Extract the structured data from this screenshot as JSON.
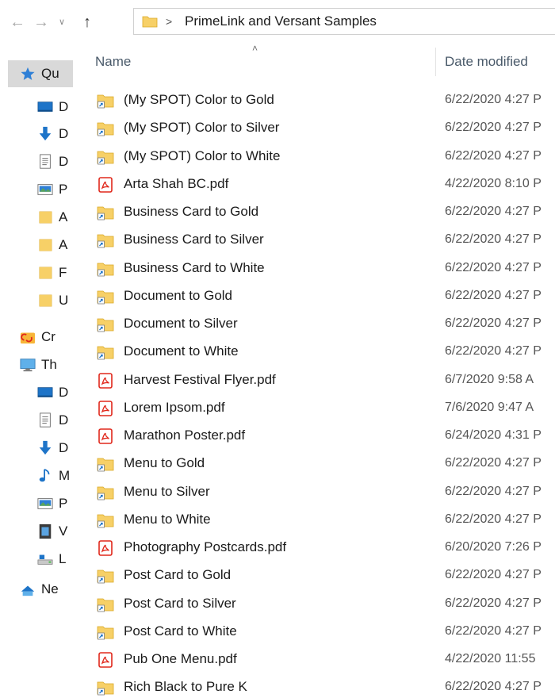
{
  "address_bar": {
    "breadcrumb_separator": ">",
    "current_folder": "PrimeLink and Versant Samples"
  },
  "nav_pane": {
    "items": [
      {
        "icon": "star-icon",
        "label": "Qu",
        "selected": true
      },
      {
        "icon": "desktop-icon",
        "label": "D"
      },
      {
        "icon": "download-icon",
        "label": "D"
      },
      {
        "icon": "documents-icon",
        "label": "D"
      },
      {
        "icon": "pictures-icon",
        "label": "P"
      },
      {
        "icon": "folder-icon",
        "label": "A"
      },
      {
        "icon": "folder-icon",
        "label": "A"
      },
      {
        "icon": "folder-icon",
        "label": "F"
      },
      {
        "icon": "folder-icon",
        "label": "U"
      },
      {
        "icon": "creative-cloud-icon",
        "label": "Cr"
      },
      {
        "icon": "this-pc-icon",
        "label": "Th"
      },
      {
        "icon": "desktop-icon",
        "label": "D"
      },
      {
        "icon": "documents-icon",
        "label": "D"
      },
      {
        "icon": "download-icon",
        "label": "D"
      },
      {
        "icon": "music-icon",
        "label": "M"
      },
      {
        "icon": "pictures-icon",
        "label": "P"
      },
      {
        "icon": "videos-icon",
        "label": "V"
      },
      {
        "icon": "local-disk-icon",
        "label": "L"
      },
      {
        "icon": "network-icon",
        "label": "Ne"
      }
    ]
  },
  "columns": {
    "name": "Name",
    "date_modified": "Date modified"
  },
  "files": [
    {
      "name": "(My SPOT) Color to Gold",
      "date": "6/22/2020 4:27 P",
      "type": "folder-shortcut"
    },
    {
      "name": "(My SPOT) Color to Silver",
      "date": "6/22/2020 4:27 P",
      "type": "folder-shortcut"
    },
    {
      "name": "(My SPOT) Color to White",
      "date": "6/22/2020 4:27 P",
      "type": "folder-shortcut"
    },
    {
      "name": "Arta Shah BC.pdf",
      "date": "4/22/2020 8:10 P",
      "type": "pdf"
    },
    {
      "name": "Business Card to Gold",
      "date": "6/22/2020 4:27 P",
      "type": "folder-shortcut"
    },
    {
      "name": "Business Card to Silver",
      "date": "6/22/2020 4:27 P",
      "type": "folder-shortcut"
    },
    {
      "name": "Business Card to White",
      "date": "6/22/2020 4:27 P",
      "type": "folder-shortcut"
    },
    {
      "name": "Document to Gold",
      "date": "6/22/2020 4:27 P",
      "type": "folder-shortcut"
    },
    {
      "name": "Document to Silver",
      "date": "6/22/2020 4:27 P",
      "type": "folder-shortcut"
    },
    {
      "name": "Document to White",
      "date": "6/22/2020 4:27 P",
      "type": "folder-shortcut"
    },
    {
      "name": "Harvest Festival Flyer.pdf",
      "date": "6/7/2020 9:58 A",
      "type": "pdf"
    },
    {
      "name": "Lorem Ipsom.pdf",
      "date": "7/6/2020 9:47 A",
      "type": "pdf"
    },
    {
      "name": "Marathon Poster.pdf",
      "date": "6/24/2020 4:31 P",
      "type": "pdf"
    },
    {
      "name": "Menu to Gold",
      "date": "6/22/2020 4:27 P",
      "type": "folder-shortcut"
    },
    {
      "name": "Menu to Silver",
      "date": "6/22/2020 4:27 P",
      "type": "folder-shortcut"
    },
    {
      "name": "Menu to White",
      "date": "6/22/2020 4:27 P",
      "type": "folder-shortcut"
    },
    {
      "name": "Photography Postcards.pdf",
      "date": "6/20/2020 7:26 P",
      "type": "pdf"
    },
    {
      "name": "Post Card to Gold",
      "date": "6/22/2020 4:27 P",
      "type": "folder-shortcut"
    },
    {
      "name": "Post Card to Silver",
      "date": "6/22/2020 4:27 P",
      "type": "folder-shortcut"
    },
    {
      "name": "Post Card to White",
      "date": "6/22/2020 4:27 P",
      "type": "folder-shortcut"
    },
    {
      "name": "Pub One Menu.pdf",
      "date": "4/22/2020 11:55",
      "type": "pdf"
    },
    {
      "name": "Rich Black to Pure K",
      "date": "6/22/2020 4:27 P",
      "type": "folder-shortcut"
    }
  ],
  "colors": {
    "folder": "#f7d067",
    "pdf": "#e0281c",
    "selected": "#d9d9d9",
    "accent_blue": "#1e74c8"
  }
}
